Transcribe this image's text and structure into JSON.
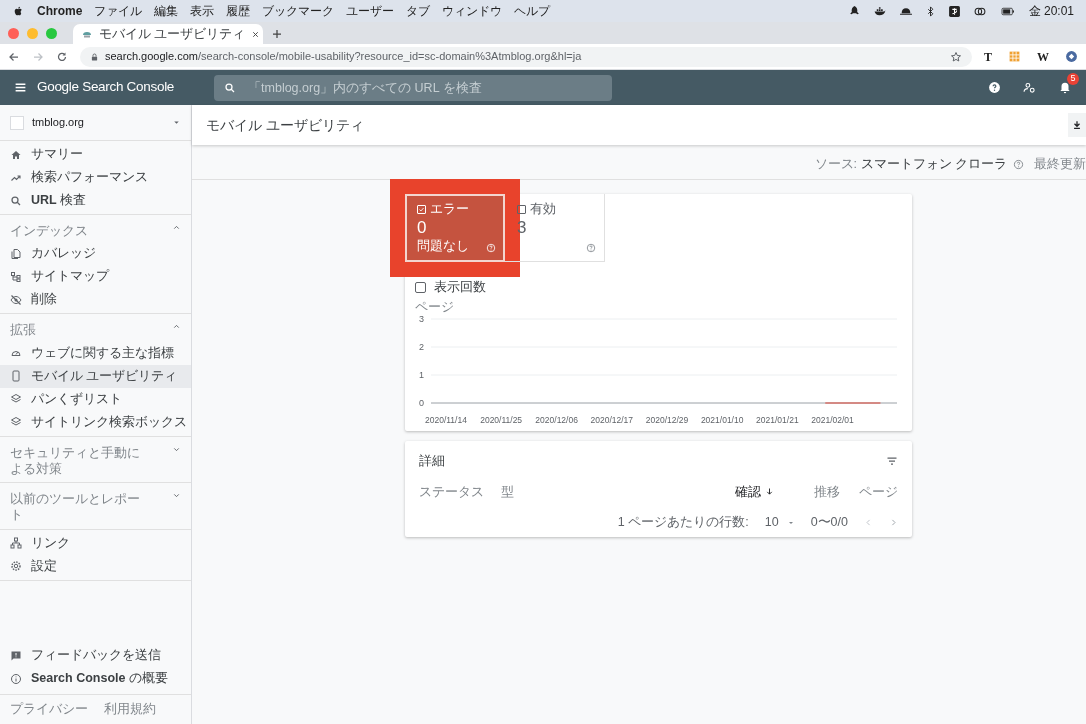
{
  "mac_menubar": {
    "app": "Chrome",
    "menus": [
      "ファイル",
      "編集",
      "表示",
      "履歴",
      "ブックマーク",
      "ユーザー",
      "タブ",
      "ウィンドウ",
      "ヘルプ"
    ],
    "clock": "金 20:01"
  },
  "browser": {
    "tab_title": "モバイル ユーザビリティ",
    "url_host": "search.google.com",
    "url_path": "/search-console/mobile-usability?resource_id=sc-domain%3Atmblog.org&hl=ja",
    "extensions": [
      "T",
      "W"
    ]
  },
  "header": {
    "logo": "Google Search Console",
    "search_placeholder": "「tmblog.org」内のすべての URL を検査",
    "notification_count": "5"
  },
  "sidebar": {
    "property": "tmblog.org",
    "sections": [
      {
        "items": [
          {
            "kind": "home",
            "label": "サマリー",
            "selected": false
          },
          {
            "kind": "trend",
            "label": "検索パフォーマンス",
            "selected": false
          },
          {
            "kind": "search",
            "label": "**URL** 検査",
            "selected": false
          }
        ]
      },
      {
        "heading": "インデックス",
        "expanded": true,
        "items": [
          {
            "kind": "pages",
            "label": "カバレッジ",
            "selected": false
          },
          {
            "kind": "sitemap",
            "label": "サイトマップ",
            "selected": false
          },
          {
            "kind": "eyeoff",
            "label": "削除",
            "selected": false
          }
        ]
      },
      {
        "heading": "拡張",
        "expanded": true,
        "items": [
          {
            "kind": "gauge",
            "label": "ウェブに関する主な指標",
            "selected": false
          },
          {
            "kind": "phone",
            "label": "モバイル ユーザビリティ",
            "selected": true
          },
          {
            "kind": "layers",
            "label": "パンくずリスト",
            "selected": false
          },
          {
            "kind": "layers",
            "label": "サイトリンク検索ボックス",
            "selected": false
          }
        ]
      },
      {
        "heading": "セキュリティと手動による対策",
        "expanded": false
      },
      {
        "heading": "以前のツールとレポート",
        "expanded": false
      },
      {
        "items": [
          {
            "kind": "network",
            "label": "リンク",
            "selected": false
          },
          {
            "kind": "gear",
            "label": "設定",
            "selected": false
          }
        ]
      }
    ],
    "footer_items": [
      {
        "kind": "feedback",
        "label": "フィードバックを送信"
      },
      {
        "kind": "info",
        "label": "**Search Console** の概要"
      }
    ],
    "legal_links": [
      "プライバシー",
      "利用規約"
    ]
  },
  "page": {
    "title": "モバイル ユーザビリティ",
    "source_label": "ソース:",
    "source_value": "スマートフォン クローラ",
    "last_updated": "最終更新"
  },
  "summary_tiles": [
    {
      "label": "エラー",
      "value": "0",
      "caption": "問題なし",
      "selected": true,
      "highlighted": true
    },
    {
      "label": "有効",
      "value": "3",
      "selected": false,
      "highlighted": false
    }
  ],
  "impressions_toggle": {
    "label": "表示回数",
    "checked": false
  },
  "chart_data": {
    "type": "line",
    "ylabel": "ページ",
    "categories": [
      "2020/11/14",
      "2020/11/25",
      "2020/12/06",
      "2020/12/17",
      "2020/12/29",
      "2021/01/10",
      "2021/01/21",
      "2021/02/01",
      null
    ],
    "series": [
      {
        "color": "#db4437",
        "values": [
          null,
          null,
          null,
          null,
          null,
          null,
          null,
          0,
          0
        ]
      }
    ],
    "ylim": [
      0,
      3
    ],
    "yticks": [
      0,
      1,
      2,
      3
    ]
  },
  "details": {
    "title": "詳細",
    "columns": [
      {
        "label": "ステータス",
        "sorted": false
      },
      {
        "label": "型",
        "sorted": false
      },
      {
        "label": "確認",
        "sorted": true
      },
      {
        "label": "推移",
        "sorted": false
      },
      {
        "label": "ページ",
        "sorted": false
      }
    ],
    "rows_per_page_label": "1 ページあたりの行数:",
    "rows_per_page": "10",
    "range": "0〜0/0"
  }
}
